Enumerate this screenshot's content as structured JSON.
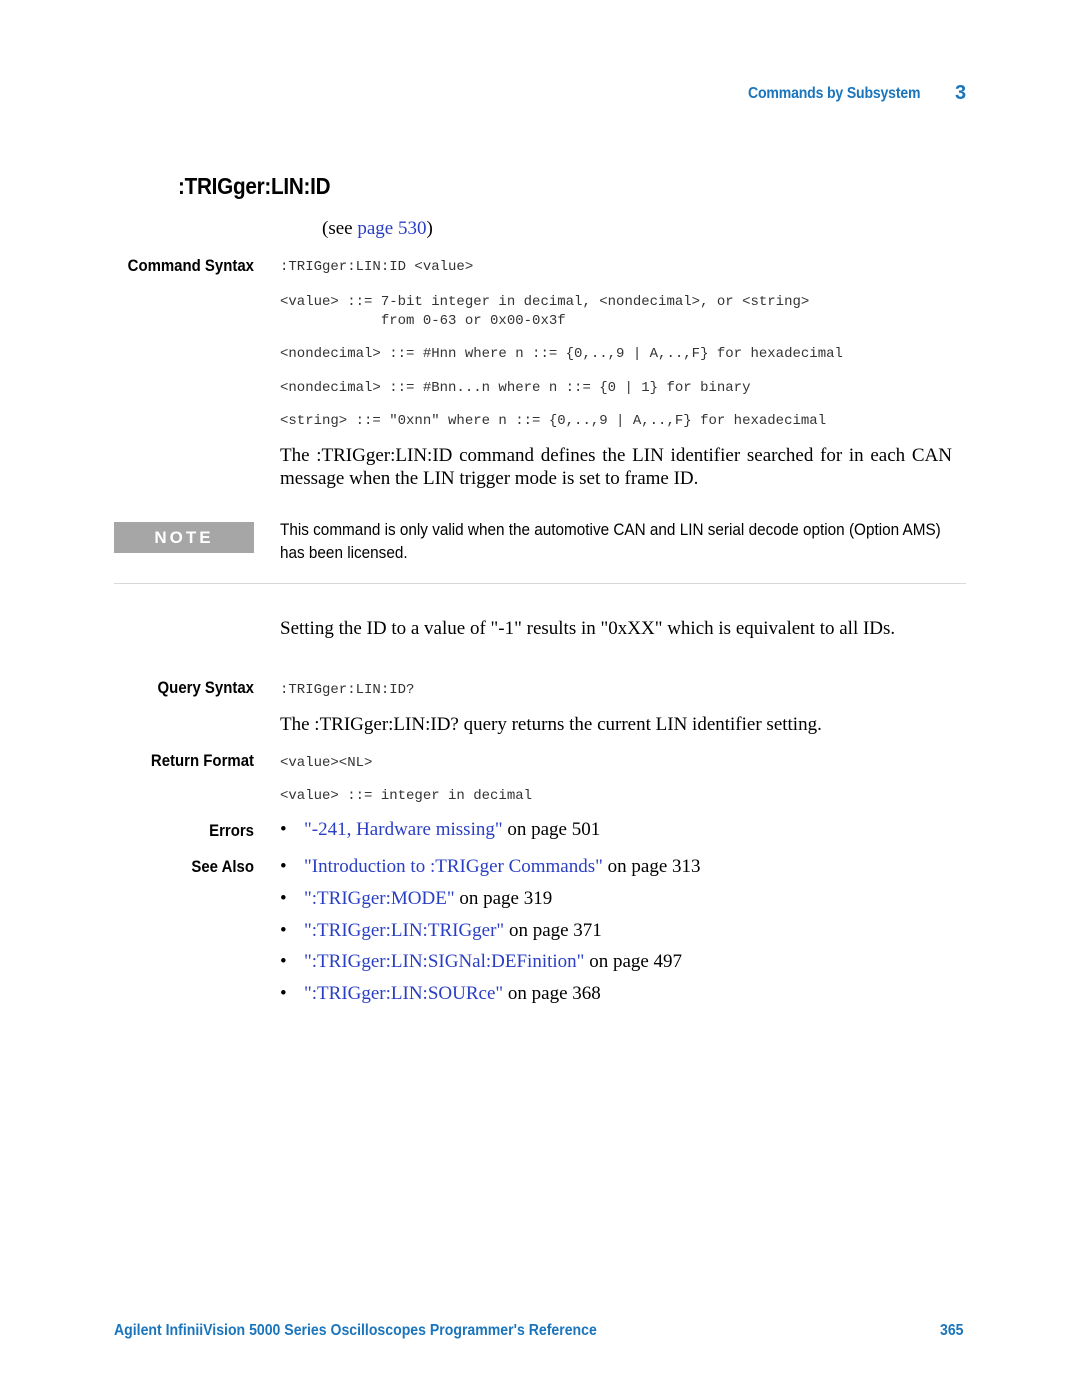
{
  "header": {
    "section_title": "Commands by Subsystem",
    "chapter_number": "3"
  },
  "command": {
    "title": ":TRIGger:LIN:ID",
    "see_prefix": "(see ",
    "see_link": "page 530",
    "see_suffix": ")"
  },
  "command_syntax": {
    "label": "Command Syntax",
    "syntax": ":TRIGger:LIN:ID <value>",
    "definitions": [
      "<value> ::= 7-bit integer in decimal, <nondecimal>, or <string>\n            from 0-63 or 0x00-0x3f",
      "<nondecimal> ::= #Hnn where n ::= {0,..,9 | A,..,F} for hexadecimal",
      "<nondecimal> ::= #Bnn...n where n ::= {0 | 1} for binary",
      "<string> ::= \"0xnn\" where n ::= {0,..,9 | A,..,F} for hexadecimal"
    ],
    "description": "The :TRIGger:LIN:ID command defines the LIN identifier searched for in each CAN message when the LIN trigger mode is set to frame ID."
  },
  "note": {
    "badge": "NOTE",
    "text": "This command is only valid when the automotive CAN and LIN serial decode option (Option AMS) has been licensed."
  },
  "extra_description": "Setting the ID to a value of \"-1\" results in \"0xXX\" which is equivalent to all IDs.",
  "query_syntax": {
    "label": "Query Syntax",
    "syntax": ":TRIGger:LIN:ID?",
    "description": "The :TRIGger:LIN:ID? query returns the current LIN identifier setting."
  },
  "return_format": {
    "label": "Return Format",
    "lines": [
      "<value><NL>",
      "<value> ::= integer in decimal"
    ]
  },
  "errors": {
    "label": "Errors",
    "items": [
      {
        "link": "\"-241, Hardware missing\"",
        "suffix": " on page 501"
      }
    ]
  },
  "see_also": {
    "label": "See Also",
    "items": [
      {
        "link": "\"Introduction to :TRIGger Commands\"",
        "suffix": " on page 313"
      },
      {
        "link": "\":TRIGger:MODE\"",
        "suffix": " on page 319"
      },
      {
        "link": "\":TRIGger:LIN:TRIGger\"",
        "suffix": " on page 371"
      },
      {
        "link": "\":TRIGger:LIN:SIGNal:DEFinition\"",
        "suffix": " on page 497"
      },
      {
        "link": "\":TRIGger:LIN:SOURce\"",
        "suffix": " on page 368"
      }
    ]
  },
  "footer": {
    "book_title": "Agilent InfiniiVision 5000 Series Oscilloscopes Programmer's Reference",
    "page_number": "365"
  }
}
